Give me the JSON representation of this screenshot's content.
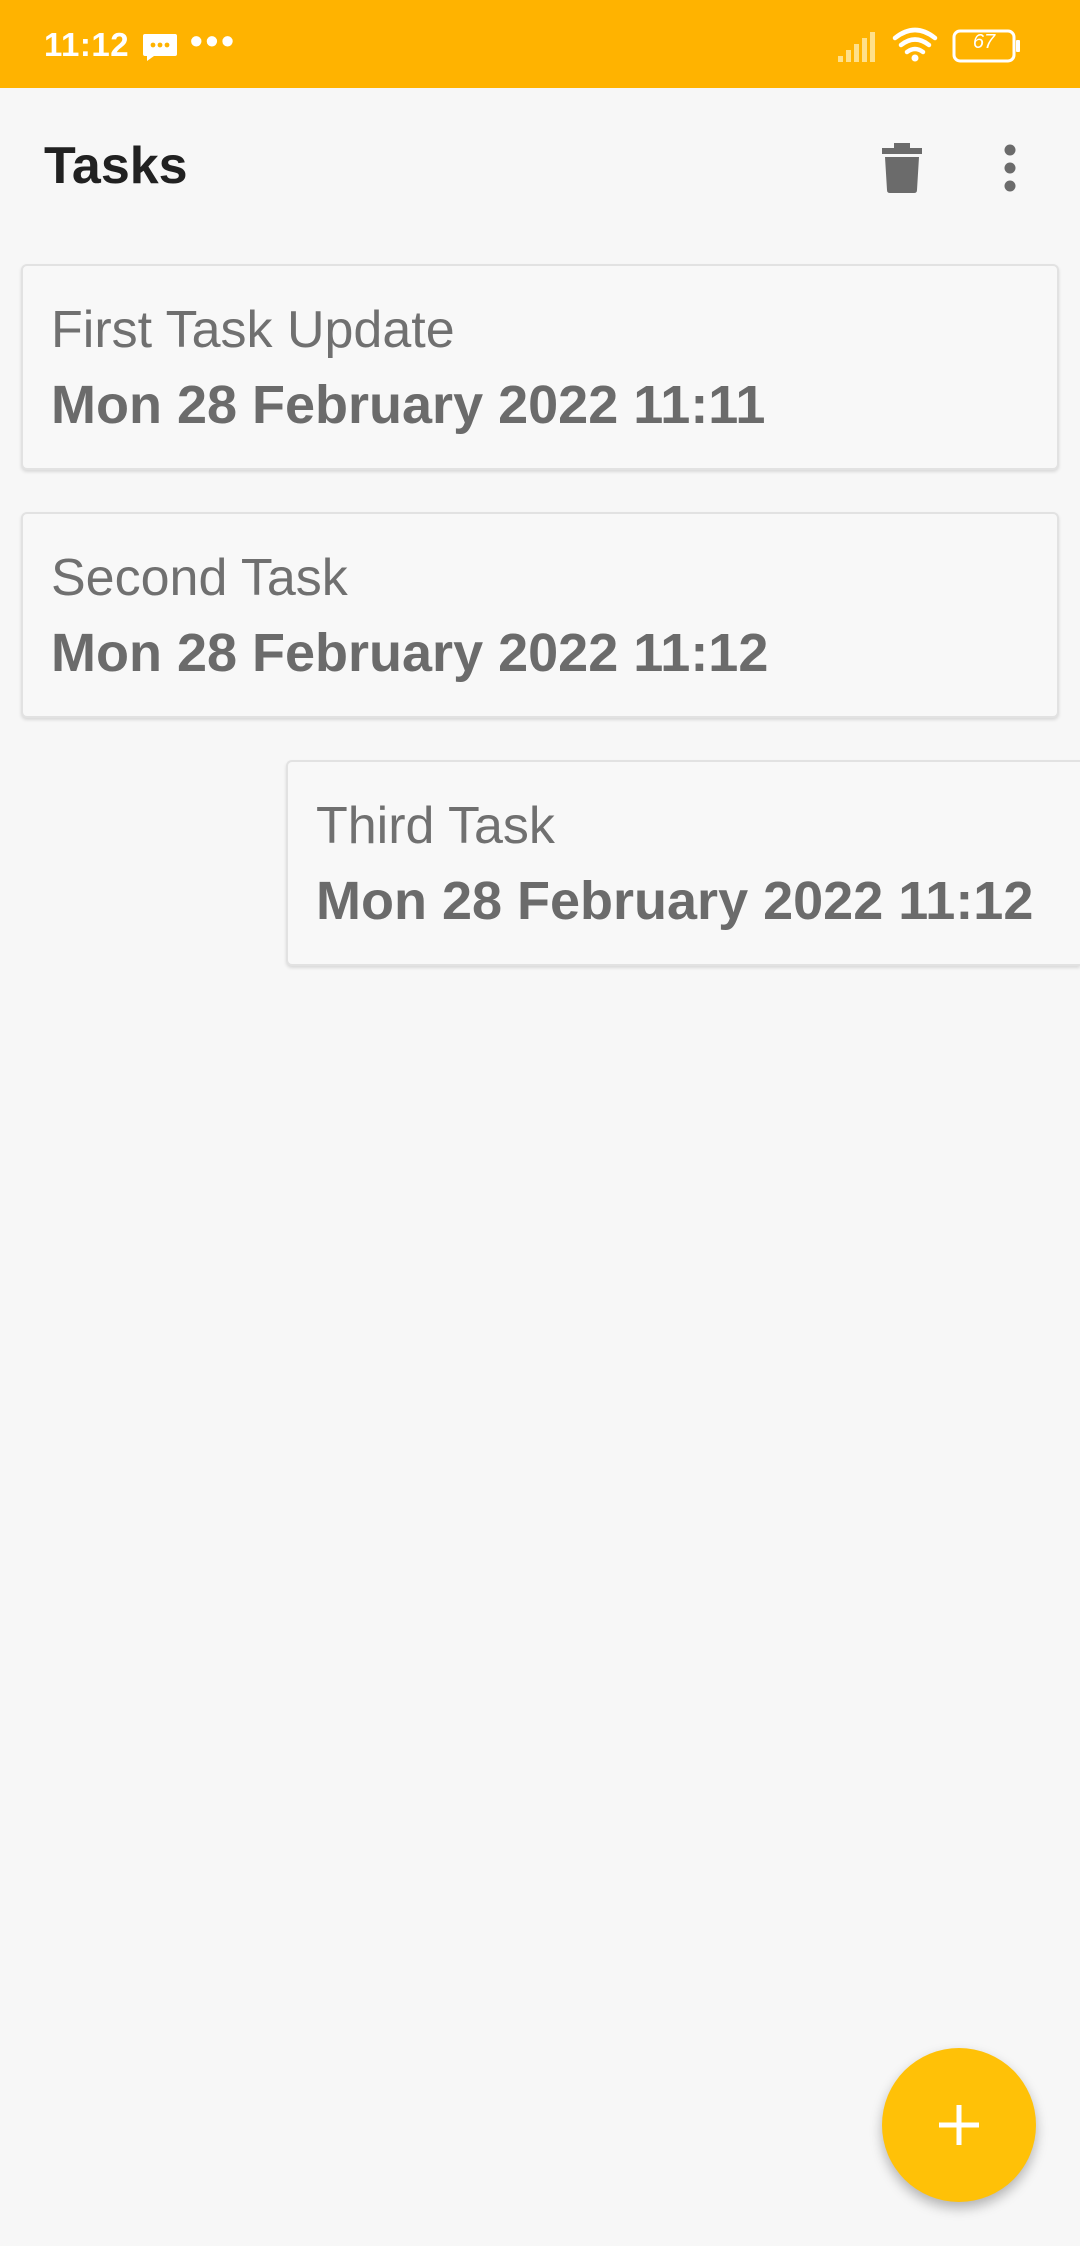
{
  "status_bar": {
    "time": "11:12",
    "notification_dots": "•••",
    "battery_level": "67",
    "icons": [
      "message-icon",
      "signal-icon",
      "wifi-icon",
      "battery-icon"
    ],
    "background_color": "#ffb300"
  },
  "app_bar": {
    "title": "Tasks",
    "actions": [
      "delete-icon",
      "more-vert-icon"
    ]
  },
  "tasks": [
    {
      "title": "First Task Update",
      "date": "Mon 28 February 2022 11:11"
    },
    {
      "title": "Second Task",
      "date": "Mon 28 February 2022 11:12"
    },
    {
      "title": "Third Task",
      "date": "Mon 28 February 2022 11:12"
    }
  ],
  "fab": {
    "icon": "add-icon",
    "color": "#ffc107"
  }
}
